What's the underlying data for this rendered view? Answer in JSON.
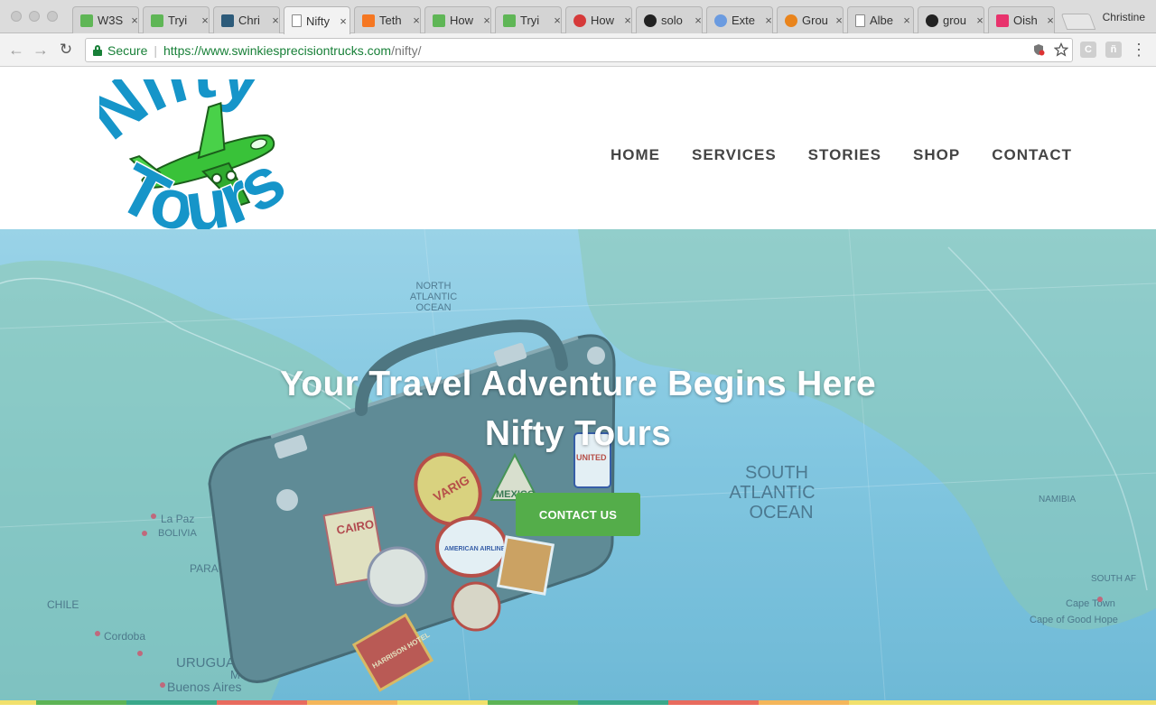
{
  "browser": {
    "profile_name": "Christine",
    "tabs": [
      {
        "title": "W3S",
        "favicon": "w3-icon",
        "color": "#5fb656",
        "active": false
      },
      {
        "title": "Tryi",
        "favicon": "w3-icon",
        "color": "#5fb656",
        "active": false
      },
      {
        "title": "Chri",
        "favicon": "cs-icon",
        "color": "#2d5b7a",
        "active": false
      },
      {
        "title": "Nifty",
        "favicon": "document-icon",
        "color": "#ffffff",
        "active": true
      },
      {
        "title": "Teth",
        "favicon": "hubspot-icon",
        "color": "#f57722",
        "active": false
      },
      {
        "title": "How",
        "favicon": "w3-icon",
        "color": "#5fb656",
        "active": false
      },
      {
        "title": "Tryi",
        "favicon": "w3-icon",
        "color": "#5fb656",
        "active": false
      },
      {
        "title": "How",
        "favicon": "gear-icon",
        "color": "#d63a3a",
        "active": false
      },
      {
        "title": "solo",
        "favicon": "github-icon",
        "color": "#222222",
        "active": false
      },
      {
        "title": "Exte",
        "favicon": "cloud-icon",
        "color": "#6b9be0",
        "active": false
      },
      {
        "title": "Grou",
        "favicon": "bitcoin-icon",
        "color": "#e9841c",
        "active": false
      },
      {
        "title": "Albe",
        "favicon": "document-icon",
        "color": "#ffffff",
        "active": false
      },
      {
        "title": "grou",
        "favicon": "github-icon",
        "color": "#222222",
        "active": false
      },
      {
        "title": "Oish",
        "favicon": "invision-icon",
        "color": "#e8336d",
        "active": false
      }
    ],
    "address": {
      "secure_label": "Secure",
      "url_host": "https://www.swinkiesprecisiontrucks.com",
      "url_path": "/nifty/"
    }
  },
  "site": {
    "logo": {
      "line1": "Nifty",
      "line2": "Tours"
    },
    "nav": [
      "HOME",
      "SERVICES",
      "STORIES",
      "SHOP",
      "CONTACT"
    ],
    "hero": {
      "title_line1": "Your Travel Adventure Begins Here",
      "title_line2": "Nifty Tours",
      "cta_label": "CONTACT US",
      "map_labels": {
        "ocean": [
          "SOUTH",
          "ATLANTIC",
          "OCEAN"
        ],
        "north_atlantic": [
          "NORTH",
          "ATLANTIC",
          "OCEAN"
        ],
        "cities": [
          "La Paz",
          "BOLIVIA",
          "Cordoba",
          "URUGUAY",
          "Buenos Aires",
          "Monte",
          "CHILE",
          "PARAG",
          "Cape Town",
          "Cape of Good Hope",
          "SOUTH AF",
          "NAMIBIA"
        ]
      },
      "stickers": [
        "CAIRO",
        "VARIG",
        "MEXICO",
        "UNITED",
        "AMERICAN AIRLINES",
        "HARRISON HOTEL"
      ]
    },
    "colors": {
      "brand_blue": "#1695c9",
      "cta_green": "#54ad4a",
      "nav_text": "#444444",
      "stripe": [
        "#f1e06c",
        "#5db455",
        "#3aa88a",
        "#e86b5e",
        "#f4b65a",
        "#f1e06c",
        "#5db455",
        "#3aa88a",
        "#e86b5e",
        "#f4b65a",
        "#f1e06c"
      ]
    }
  }
}
